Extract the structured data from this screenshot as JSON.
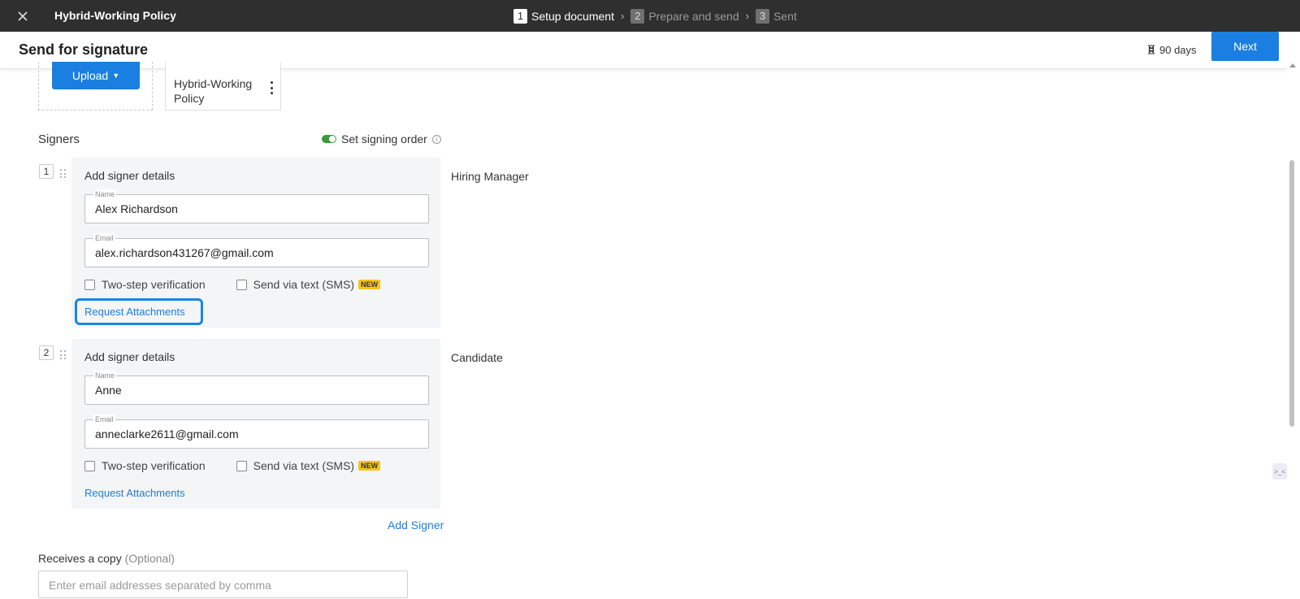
{
  "topbar": {
    "doc_title": "Hybrid-Working Policy",
    "steps": [
      {
        "num": "1",
        "label": "Setup document"
      },
      {
        "num": "2",
        "label": "Prepare and send"
      },
      {
        "num": "3",
        "label": "Sent"
      }
    ]
  },
  "header": {
    "title": "Send for signature",
    "expiry": "90 days",
    "next_label": "Next"
  },
  "upload": {
    "button_label": "Upload",
    "document_name": "Hybrid-Working Policy"
  },
  "signers": {
    "title": "Signers",
    "signing_order_label": "Set signing order",
    "list": [
      {
        "index": "1",
        "card_title": "Add signer details",
        "name_legend": "Name",
        "name": "Alex Richardson",
        "email_legend": "Email",
        "email": "alex.richardson431267@gmail.com",
        "two_step_label": "Two-step verification",
        "sms_label": "Send via text (SMS)",
        "new_badge": "NEW",
        "request_attachments": "Request Attachments",
        "role": "Hiring Manager"
      },
      {
        "index": "2",
        "card_title": "Add signer details",
        "name_legend": "Name",
        "name": "Anne",
        "email_legend": "Email",
        "email": "anneclarke2611@gmail.com",
        "two_step_label": "Two-step verification",
        "sms_label": "Send via text (SMS)",
        "new_badge": "NEW",
        "request_attachments": "Request Attachments",
        "role": "Candidate"
      }
    ],
    "add_signer_label": "Add Signer"
  },
  "copy": {
    "label": "Receives a copy",
    "optional": "(Optional)",
    "placeholder": "Enter email addresses separated by comma"
  },
  "colors": {
    "accent": "#1a7fe0",
    "topbar": "#2f2f2f",
    "toggle_on": "#3a9b3a",
    "highlight": "#1588e0",
    "new_badge": "#f5c518"
  },
  "icons": [
    "close-icon",
    "chevron-right-icon",
    "hourglass-icon",
    "caret-down-icon",
    "kebab-menu-icon",
    "toggle-icon",
    "info-icon",
    "drag-handle-icon"
  ]
}
